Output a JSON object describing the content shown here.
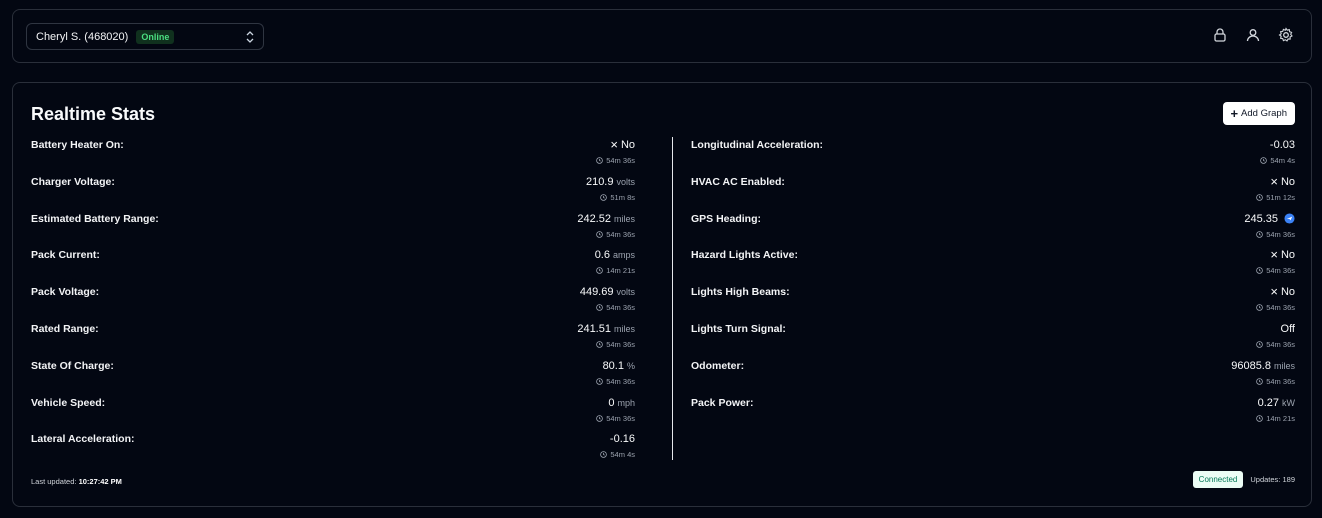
{
  "header": {
    "vehicle_selector": "Cheryl S. (468020)",
    "status_badge": "Online",
    "icons": [
      "lock-icon",
      "user-icon",
      "gear-icon"
    ]
  },
  "panel": {
    "title": "Realtime Stats",
    "add_graph_label": "Add Graph",
    "left_stats": [
      {
        "label": "Battery Heater On:",
        "value": "No",
        "unit": "",
        "age": "54m 36s",
        "x": true
      },
      {
        "label": "Charger Voltage:",
        "value": "210.9",
        "unit": "volts",
        "age": "51m 8s"
      },
      {
        "label": "Estimated Battery Range:",
        "value": "242.52",
        "unit": "miles",
        "age": "54m 36s"
      },
      {
        "label": "Pack Current:",
        "value": "0.6",
        "unit": "amps",
        "age": "14m 21s"
      },
      {
        "label": "Pack Voltage:",
        "value": "449.69",
        "unit": "volts",
        "age": "54m 36s"
      },
      {
        "label": "Rated Range:",
        "value": "241.51",
        "unit": "miles",
        "age": "54m 36s"
      },
      {
        "label": "State Of Charge:",
        "value": "80.1",
        "unit": "%",
        "age": "54m 36s"
      },
      {
        "label": "Vehicle Speed:",
        "value": "0",
        "unit": "mph",
        "age": "54m 36s"
      },
      {
        "label": "Lateral Acceleration:",
        "value": "-0.16",
        "unit": "",
        "age": "54m 4s"
      }
    ],
    "right_stats": [
      {
        "label": "Longitudinal Acceleration:",
        "value": "-0.03",
        "unit": "",
        "age": "54m 4s"
      },
      {
        "label": "HVAC AC Enabled:",
        "value": "No",
        "unit": "",
        "age": "51m 12s",
        "x": true
      },
      {
        "label": "GPS Heading:",
        "value": "245.35",
        "unit": "",
        "age": "54m 36s",
        "heading_icon": true
      },
      {
        "label": "Hazard Lights Active:",
        "value": "No",
        "unit": "",
        "age": "54m 36s",
        "x": true
      },
      {
        "label": "Lights High Beams:",
        "value": "No",
        "unit": "",
        "age": "54m 36s",
        "x": true
      },
      {
        "label": "Lights Turn Signal:",
        "value": "Off",
        "unit": "",
        "age": "54m 36s"
      },
      {
        "label": "Odometer:",
        "value": "96085.8",
        "unit": "miles",
        "age": "54m 36s"
      },
      {
        "label": "Pack Power:",
        "value": "0.27",
        "unit": "kW",
        "age": "14m 21s"
      }
    ],
    "footer": {
      "last_updated_label": "Last updated:",
      "last_updated_time": "10:27:42 PM",
      "connection_badge": "Connected",
      "updates_label": "Updates: 189"
    }
  },
  "colors": {
    "background": "#030712",
    "online_green": "#4ade80",
    "connected_bg": "#ecfdf5",
    "heading_blue": "#3b82f6"
  }
}
